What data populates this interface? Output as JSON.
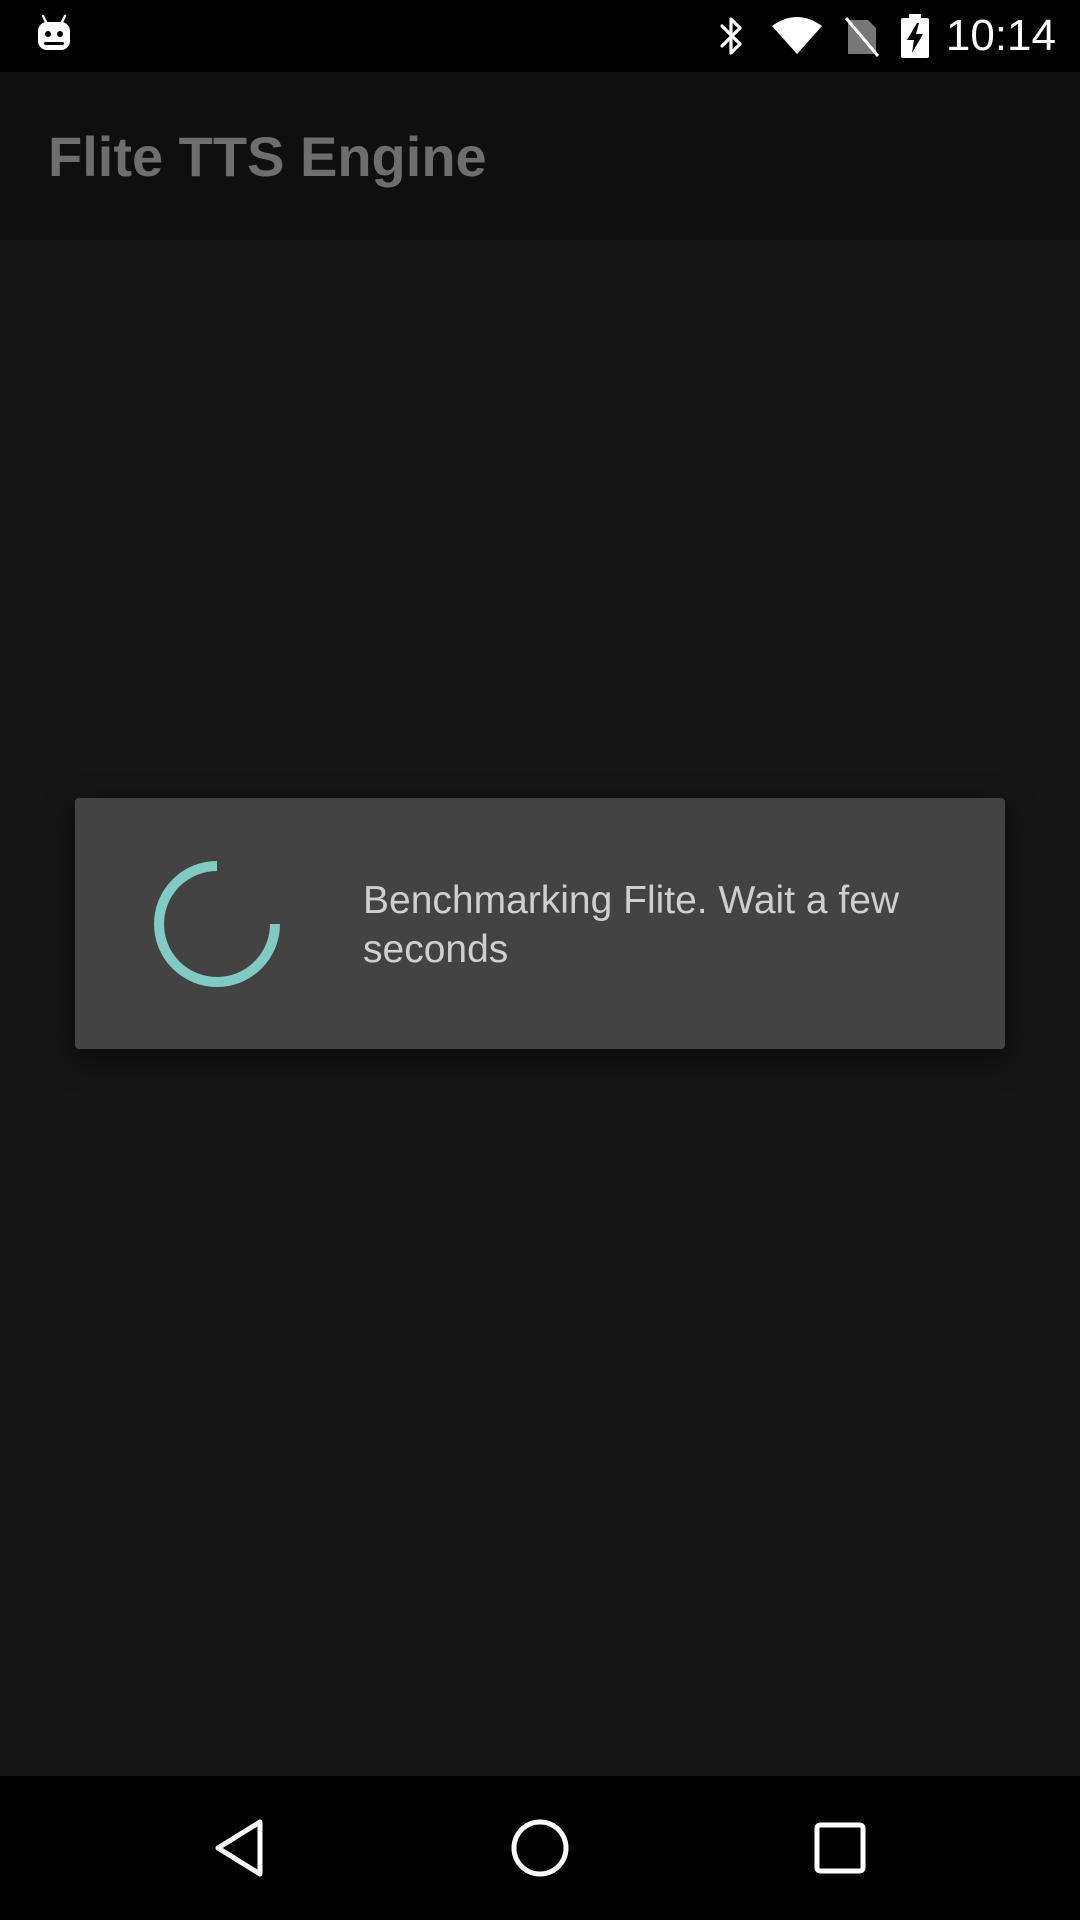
{
  "status_bar": {
    "time": "10:14",
    "icons": [
      "android-notification-icon",
      "bluetooth-icon",
      "wifi-icon",
      "no-sim-icon",
      "battery-charging-icon"
    ]
  },
  "app_bar": {
    "title": "Flite TTS Engine"
  },
  "dialog": {
    "message": "Benchmarking Flite. Wait a few seconds",
    "accent_color": "#80CBC4"
  },
  "nav_bar": {
    "buttons": [
      "back-icon",
      "home-icon",
      "recents-icon"
    ]
  }
}
